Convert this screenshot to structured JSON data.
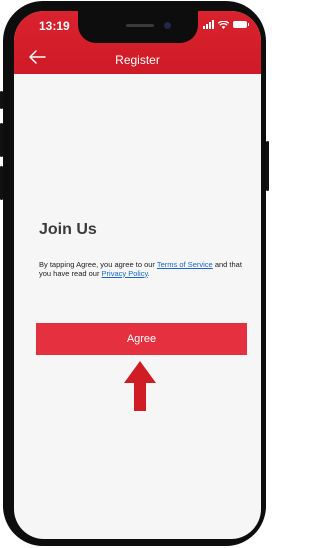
{
  "status_bar": {
    "time": "13:19"
  },
  "header": {
    "title": "Register",
    "back_icon": "back-arrow-icon",
    "color": "#d9222e"
  },
  "content": {
    "heading": "Join Us",
    "terms_prefix": "By tapping Agree, you agree to our ",
    "terms_link": "Terms of Service",
    "terms_middle": " and that you have read our ",
    "privacy_link": "Privacy Policy",
    "terms_suffix": "."
  },
  "agree_button": {
    "label": "Agree",
    "color": "#e5303f"
  },
  "annotation": {
    "icon": "up-arrow-icon",
    "color": "#d01c25"
  }
}
